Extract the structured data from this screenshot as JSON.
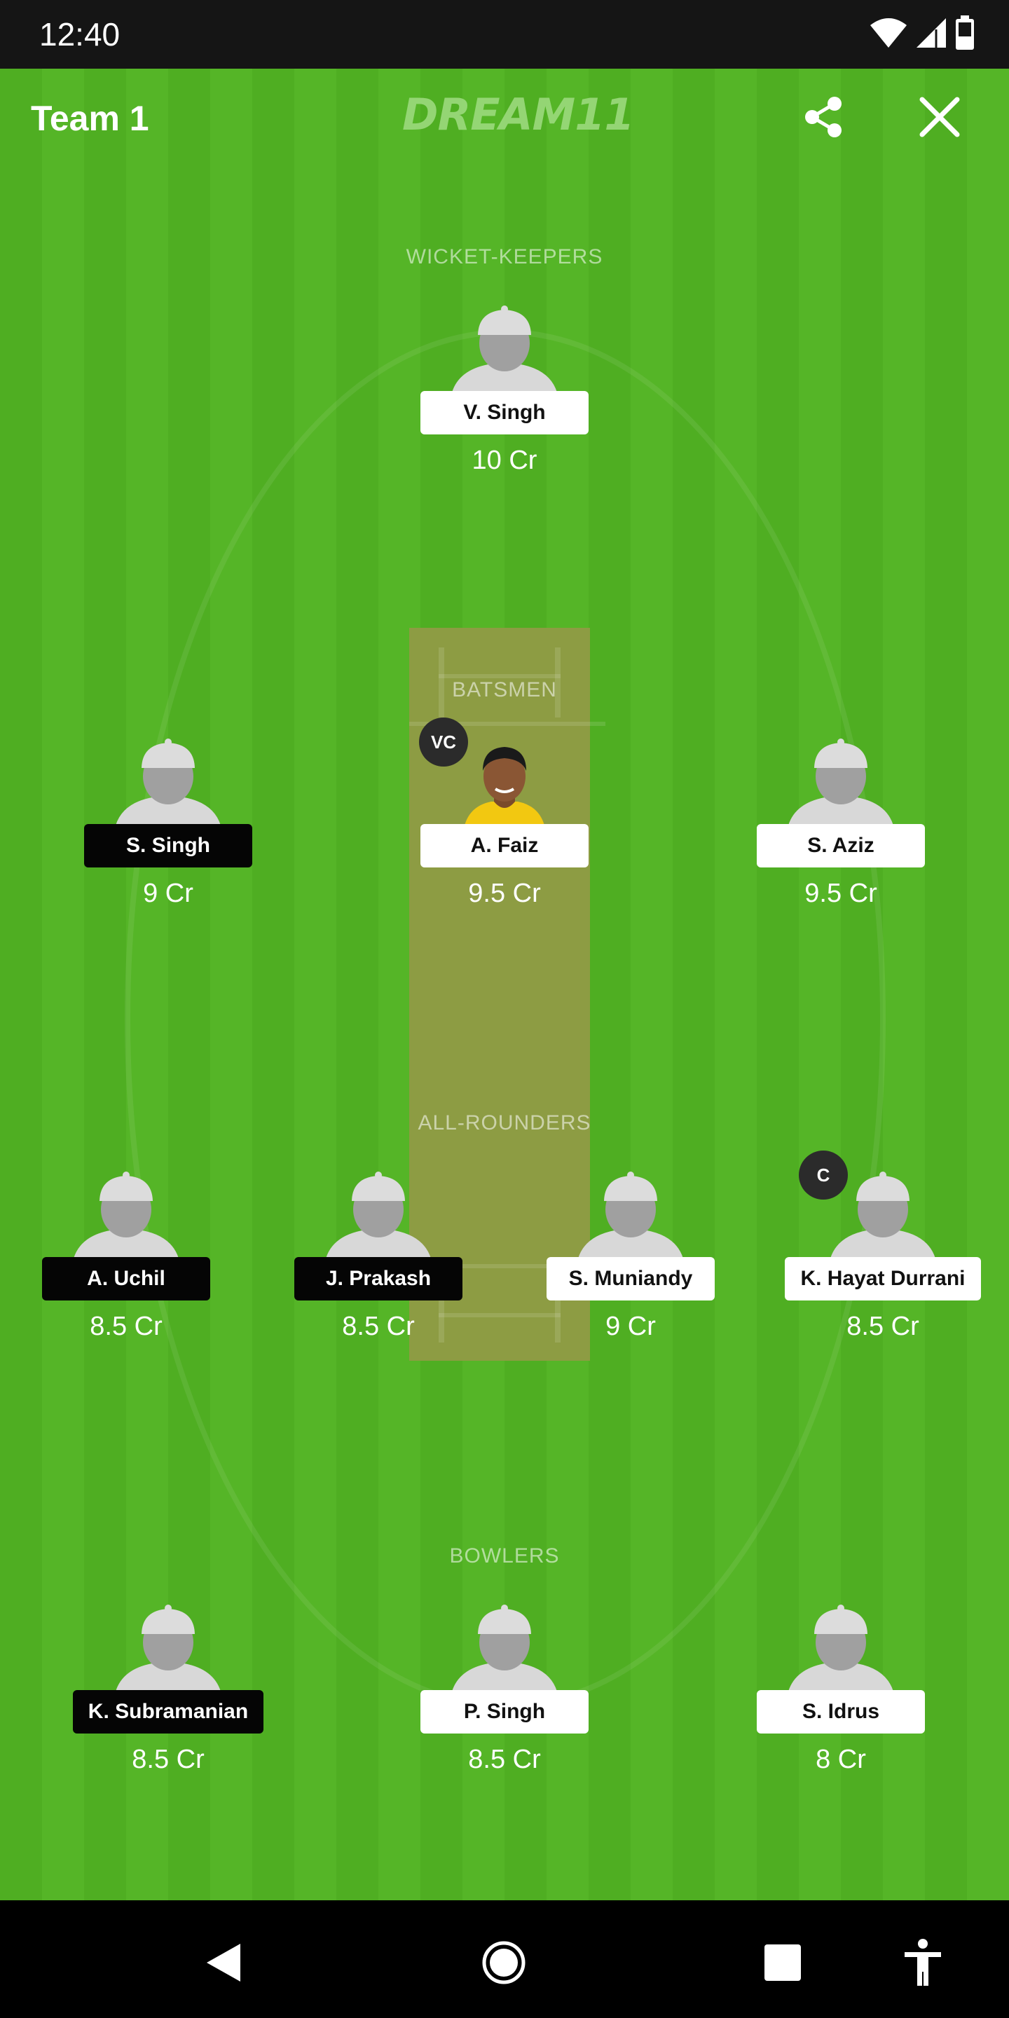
{
  "status_bar": {
    "time": "12:40",
    "icons": [
      "wifi-icon",
      "signal-icon",
      "battery-icon"
    ]
  },
  "header": {
    "title": "Team 1",
    "logo_text": "DREAM11",
    "actions": [
      "share-icon",
      "close-icon"
    ]
  },
  "sections": {
    "wicket_keepers": "WICKET-KEEPERS",
    "batsmen": "BATSMEN",
    "all_rounders": "ALL-ROUNDERS",
    "bowlers": "BOWLERS"
  },
  "players": {
    "wicket_keepers": [
      {
        "name": "V. Singh",
        "credits": "10 Cr",
        "style": "light"
      }
    ],
    "batsmen": [
      {
        "name": "S. Singh",
        "credits": "9 Cr",
        "style": "dark"
      },
      {
        "name": "A. Faiz",
        "credits": "9.5 Cr",
        "style": "light",
        "badge": "VC"
      },
      {
        "name": "S. Aziz",
        "credits": "9.5 Cr",
        "style": "light"
      }
    ],
    "all_rounders": [
      {
        "name": "A. Uchil",
        "credits": "8.5 Cr",
        "style": "dark"
      },
      {
        "name": "J. Prakash",
        "credits": "8.5 Cr",
        "style": "dark"
      },
      {
        "name": "S. Muniandy",
        "credits": "9 Cr",
        "style": "light"
      },
      {
        "name": "K. Hayat Durrani",
        "credits": "8.5 Cr",
        "style": "light",
        "badge": "C"
      }
    ],
    "bowlers": [
      {
        "name": "K. Subramanian",
        "credits": "8.5 Cr",
        "style": "dark"
      },
      {
        "name": "P. Singh",
        "credits": "8.5 Cr",
        "style": "light"
      },
      {
        "name": "S. Idrus",
        "credits": "8 Cr",
        "style": "light"
      }
    ]
  },
  "colors": {
    "field_dark": "#4fae22",
    "field_light": "#55b527",
    "pitch": "#8d9c43",
    "badge": "#2b2b2b"
  },
  "nav_bar": {
    "buttons": [
      "back-icon",
      "home-icon",
      "recents-icon",
      "accessibility-icon"
    ]
  }
}
